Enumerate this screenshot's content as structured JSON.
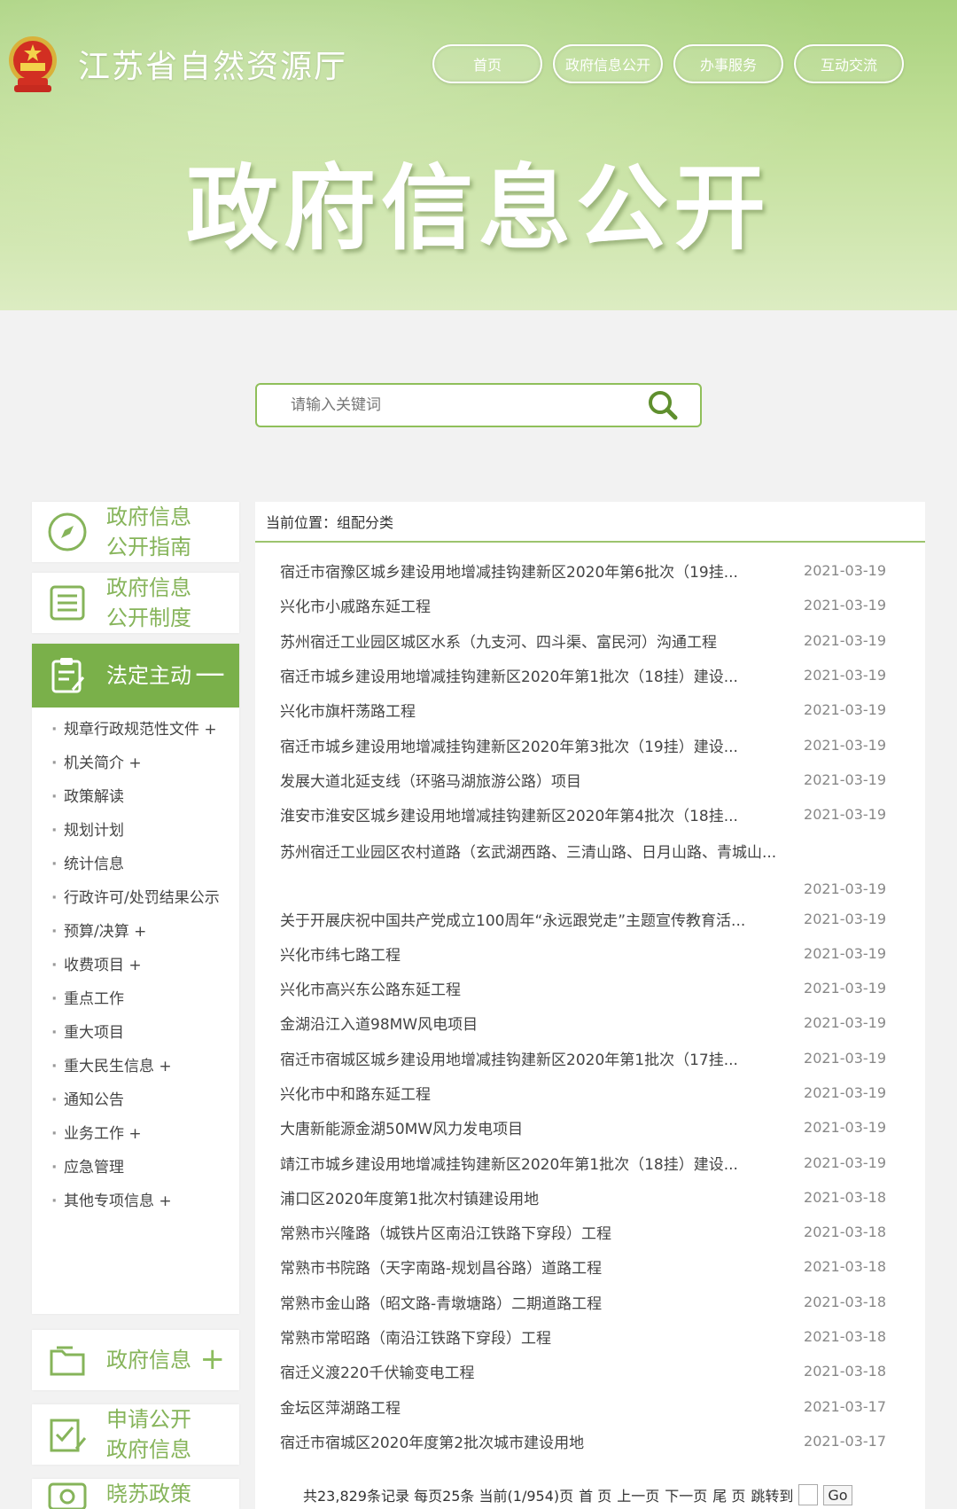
{
  "header": {
    "site_title": "江苏省自然资源厅",
    "nav": [
      "首页",
      "政府信息公开",
      "办事服务",
      "互动交流"
    ],
    "hero_title": "政府信息公开"
  },
  "search": {
    "placeholder": "请输入关键词"
  },
  "sidebar": {
    "guide": "政府信息公开指南",
    "system": "政府信息公开制度",
    "statutory": "法定主动",
    "statutory_toggle": "—",
    "items": [
      "规章行政规范性文件 +",
      "机关简介 +",
      "政策解读",
      "规划计划",
      "统计信息",
      "行政许可/处罚结果公示",
      "预算/决算 +",
      "收费项目 +",
      "重点工作",
      "重大项目",
      "重大民生信息 +",
      "通知公告",
      "业务工作 +",
      "应急管理",
      "其他专项信息 +"
    ],
    "gov_info": "政府信息",
    "gov_info_toggle": "+",
    "apply": "申请公开政府信息",
    "policy": "晓苏政策"
  },
  "content": {
    "breadcrumb": "当前位置：组配分类",
    "rows": [
      {
        "title": "宿迁市宿豫区城乡建设用地增减挂钩建新区2020年第6批次（19挂...",
        "date": "2021-03-19"
      },
      {
        "title": "兴化市小戚路东延工程",
        "date": "2021-03-19"
      },
      {
        "title": "苏州宿迁工业园区城区水系（九支河、四斗渠、富民河）沟通工程",
        "date": "2021-03-19"
      },
      {
        "title": "宿迁市城乡建设用地增减挂钩建新区2020年第1批次（18挂）建设...",
        "date": "2021-03-19"
      },
      {
        "title": "兴化市旗杆荡路工程",
        "date": "2021-03-19"
      },
      {
        "title": "宿迁市城乡建设用地增减挂钩建新区2020年第3批次（19挂）建设...",
        "date": "2021-03-19"
      },
      {
        "title": "发展大道北延支线（环骆马湖旅游公路）项目",
        "date": "2021-03-19"
      },
      {
        "title": "淮安市淮安区城乡建设用地增减挂钩建新区2020年第4批次（18挂...",
        "date": "2021-03-19"
      },
      {
        "title": "苏州宿迁工业园区农村道路（玄武湖西路、三清山路、日月山路、青城山...",
        "date": "2021-03-19"
      },
      {
        "title": "关于开展庆祝中国共产党成立100周年“永远跟党走”主题宣传教育活...",
        "date": "2021-03-19"
      },
      {
        "title": "兴化市纬七路工程",
        "date": "2021-03-19"
      },
      {
        "title": "兴化市高兴东公路东延工程",
        "date": "2021-03-19"
      },
      {
        "title": "金湖沿江入道98MW风电项目",
        "date": "2021-03-19"
      },
      {
        "title": "宿迁市宿城区城乡建设用地增减挂钩建新区2020年第1批次（17挂...",
        "date": "2021-03-19"
      },
      {
        "title": "兴化市中和路东延工程",
        "date": "2021-03-19"
      },
      {
        "title": "大唐新能源金湖50MW风力发电项目",
        "date": "2021-03-19"
      },
      {
        "title": "靖江市城乡建设用地增减挂钩建新区2020年第1批次（18挂）建设...",
        "date": "2021-03-19"
      },
      {
        "title": "浦口区2020年度第1批次村镇建设用地",
        "date": "2021-03-18"
      },
      {
        "title": "常熟市兴隆路（城铁片区南沿江铁路下穿段）工程",
        "date": "2021-03-18"
      },
      {
        "title": "常熟市书院路（天字南路-规划昌谷路）道路工程",
        "date": "2021-03-18"
      },
      {
        "title": "常熟市金山路（昭文路-青墩塘路）二期道路工程",
        "date": "2021-03-18"
      },
      {
        "title": "常熟市常昭路（南沿江铁路下穿段）工程",
        "date": "2021-03-18"
      },
      {
        "title": "宿迁义渡220千伏输变电工程",
        "date": "2021-03-18"
      },
      {
        "title": "金坛区萍湖路工程",
        "date": "2021-03-17"
      },
      {
        "title": "宿迁市宿城区2020年度第2批次城市建设用地",
        "date": "2021-03-17"
      }
    ],
    "pager": {
      "summary": "共23,829条记录 每页25条 当前(1/954)页",
      "first": "首 页",
      "prev": "上一页",
      "next": "下一页",
      "last": "尾 页",
      "jump": "跳转到",
      "go": "Go"
    }
  }
}
